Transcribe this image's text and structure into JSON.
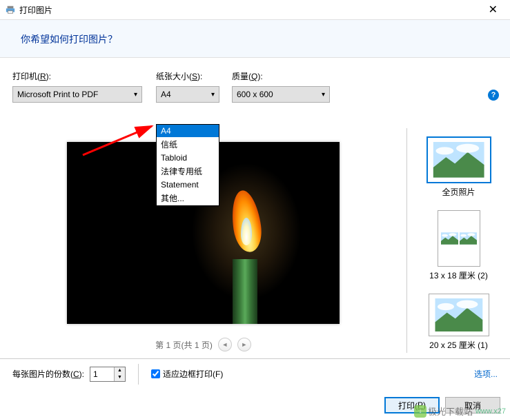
{
  "titlebar": {
    "title": "打印图片"
  },
  "header": {
    "question": "你希望如何打印图片？"
  },
  "controls": {
    "printer": {
      "label_pre": "打印机(",
      "hotkey": "R",
      "label_post": "):",
      "value": "Microsoft Print to PDF"
    },
    "paper": {
      "label_pre": "纸张大小(",
      "hotkey": "S",
      "label_post": "):",
      "value": "A4"
    },
    "quality": {
      "label_pre": "质量(",
      "hotkey": "Q",
      "label_post": "):",
      "value": "600 x 600"
    }
  },
  "paper_dropdown": {
    "items": [
      "A4",
      "信纸",
      "Tabloid",
      "法律专用纸",
      "Statement",
      "其他..."
    ],
    "selected": "A4"
  },
  "pager": {
    "text": "第 1 页(共 1 页)"
  },
  "layouts": [
    {
      "label": "全页照片",
      "selected": true,
      "cols": 1,
      "rows": 1
    },
    {
      "label": "13 x 18 厘米 (2)",
      "selected": false,
      "cols": 2,
      "rows": 1
    },
    {
      "label": "20 x 25 厘米 (1)",
      "selected": false,
      "cols": 1,
      "rows": 1
    },
    {
      "label": "",
      "selected": false,
      "cols": 2,
      "rows": 1,
      "partial": true
    }
  ],
  "bottom": {
    "copies_pre": "每张图片的份数(",
    "copies_hotkey": "C",
    "copies_post": "):",
    "copies_value": "1",
    "fit_checked": true,
    "fit_pre": "适应边框打印(",
    "fit_hotkey": "F",
    "fit_post": ")",
    "options": "选项..."
  },
  "buttons": {
    "print_pre": "打印(",
    "print_hotkey": "P",
    "print_post": ")",
    "cancel": "取消"
  },
  "help": "?",
  "watermark": {
    "text1": "极光下载站",
    "text2": "www.x27"
  }
}
